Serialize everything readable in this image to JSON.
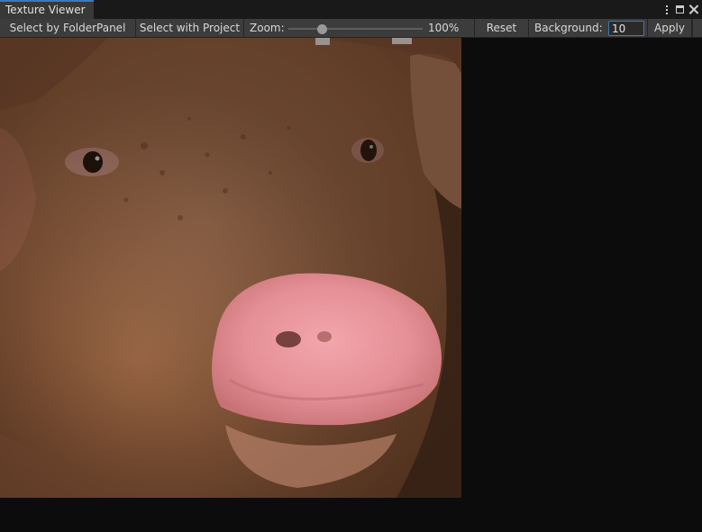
{
  "window": {
    "tab_title": "Texture Viewer",
    "controls": [
      "kebab-menu-icon",
      "maximize-icon",
      "close-icon"
    ]
  },
  "toolbar": {
    "select_folder_label": "Select by FolderPanel",
    "select_project_label": "Select with Project",
    "zoom_label": "Zoom:",
    "zoom_value": "100%",
    "zoom_fraction": 0.25,
    "reset_label": "Reset",
    "background_label": "Background:",
    "background_value": "10",
    "apply_label": "Apply"
  },
  "viewer": {
    "image_subject": "pig-face-texture"
  },
  "colors": {
    "accent": "#3a79bb",
    "toolbar_bg": "#3c3c3c",
    "viewer_bg": "#0c0c0c",
    "tab_bg": "#383838"
  }
}
